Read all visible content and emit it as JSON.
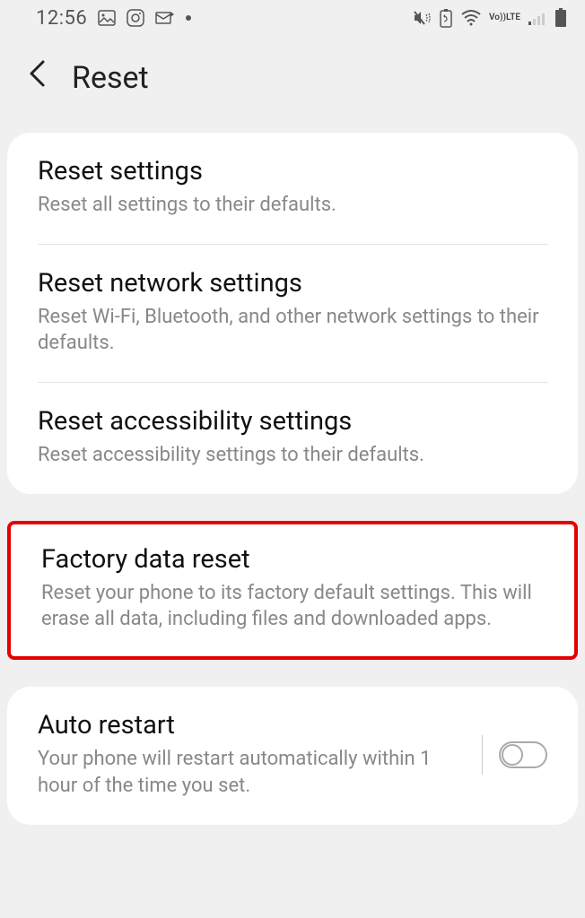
{
  "status": {
    "time": "12:56",
    "lte_top": "Vo))",
    "lte_bottom": "LTE"
  },
  "header": {
    "title": "Reset"
  },
  "card1": {
    "items": [
      {
        "title": "Reset settings",
        "subtitle": "Reset all settings to their defaults."
      },
      {
        "title": "Reset network settings",
        "subtitle": "Reset Wi-Fi, Bluetooth, and other network settings to their defaults."
      },
      {
        "title": "Reset accessibility settings",
        "subtitle": "Reset accessibility settings to their defaults."
      }
    ]
  },
  "card2": {
    "title": "Factory data reset",
    "subtitle": "Reset your phone to its factory default settings. This will erase all data, including files and downloaded apps."
  },
  "card3": {
    "title": "Auto restart",
    "subtitle": "Your phone will restart automatically within 1 hour of the time you set."
  }
}
